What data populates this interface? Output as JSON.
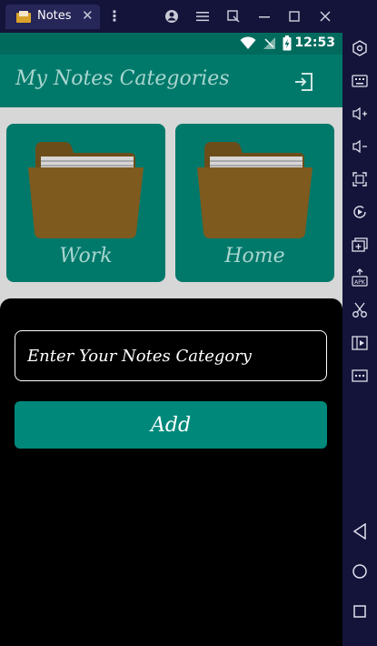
{
  "window": {
    "tab_title": "Notes",
    "tab_close": "✕"
  },
  "status_bar": {
    "time": "12:53"
  },
  "app_bar": {
    "title": "My Notes Categories"
  },
  "categories": [
    {
      "label": "Work"
    },
    {
      "label": "Home"
    }
  ],
  "bottom_sheet": {
    "input_placeholder": "Enter Your Notes Category",
    "input_value": "",
    "add_label": "Add"
  },
  "colors": {
    "app_bar": "#00796b",
    "status_bar": "#006b5d",
    "accent": "#00897b",
    "folder": "#7e5a1e"
  }
}
